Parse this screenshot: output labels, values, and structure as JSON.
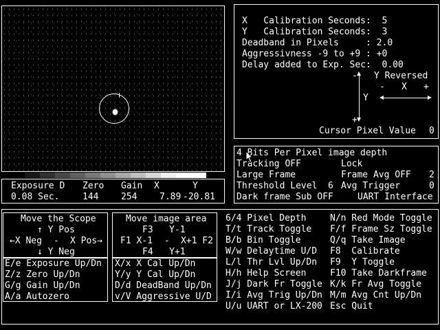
{
  "image_panel": {
    "reticle": "reticle-circle",
    "star": "star-blob",
    "grayscale": [
      "#000000",
      "#181818",
      "#303030",
      "#484848",
      "#606060",
      "#787878",
      "#909090",
      "#a8a8a8",
      "#c0c0c0",
      "#d8d8d8",
      "#f0f0f0",
      "#ffffff",
      "#ffffff"
    ]
  },
  "readout": {
    "headers": [
      "Exposure D",
      "Zero",
      "Gain",
      "X",
      "Y"
    ],
    "values": [
      "0.08 Sec.",
      "144",
      "254",
      "7.89",
      "-20.81"
    ]
  },
  "calibration": {
    "x_cal": "X   Calibration Seconds:  5",
    "y_cal": "Y   Calibration Seconds:  3",
    "deadband": "Deadband in Pixels     : 2.0",
    "aggressiveness": "Aggressivness -9 to +9 : +0",
    "delay": "Delay added to Exp. Sec:  0.00",
    "y_reversed_label": "Y Reversed",
    "plus_y": "+",
    "minus_y": "-",
    "axis_x": "X",
    "axis_y": "Y",
    "minus_x": "-",
    "plus_x": "+",
    "cursor_label": "Cursor Pixel Value",
    "cursor_value": "0"
  },
  "status": {
    "bits": "4 Bits Per Pixel image depth",
    "tracking": "Tracking OFF",
    "lock": "Lock",
    "frame_size": "Large Frame",
    "frame_avg": "Frame Avg OFF",
    "frame_avg_value": "2",
    "threshold": "Threshold Level  6",
    "avg_trigger": "Avg Trigger",
    "avg_trigger_value": "0",
    "dark_frame": "Dark frame Sub OFF",
    "uart": "UART Interface"
  },
  "move_scope": {
    "title": "Move the Scope",
    "up": "↑ Y Pos",
    "left": "←X Neg",
    "dash": "-",
    "right": "X Pos→",
    "down": "↓ Y Neg"
  },
  "move_image": {
    "title": "Move image area",
    "up": "F3   Y-1",
    "left": "F1 X-1",
    "dash": "-",
    "right": "X+1 F2",
    "down": "F4   Y+1"
  },
  "keys_left": [
    "E/e Exposure Up/Dn",
    "Z/z Zero Up/Dn",
    "G/g Gain Up/Dn",
    "A/a Autozero"
  ],
  "keys_mid": [
    "X/x X Cal Up/Dn",
    "Y/y Y Cal Up/Dn",
    "D/d DeadBand Up/Dn",
    "v/V Aggressive U/D"
  ],
  "keys_col3": [
    "6/4 Pixel Depth",
    "T/t Track Toggle",
    "B/b Bin Toggle",
    "W/w Delaytime U/D",
    "L/l Thr Lvl Up/Dn",
    "H/h Help Screen",
    "J/j Dark Fr Toggle",
    "I/i Avg Trig Up/Dn",
    "U/u UART or LX-200"
  ],
  "keys_col4": [
    "N/n Red Mode Toggle",
    "F/f Frame Sz Toggle",
    "Q/q Take Image",
    "F8  Calibrate",
    "F9  Y Toggle",
    "F10 Take Darkframe",
    "K/k Fr Avg Toggle",
    "M/m Avg Cnt Up/Dn",
    "Esc Quit"
  ]
}
